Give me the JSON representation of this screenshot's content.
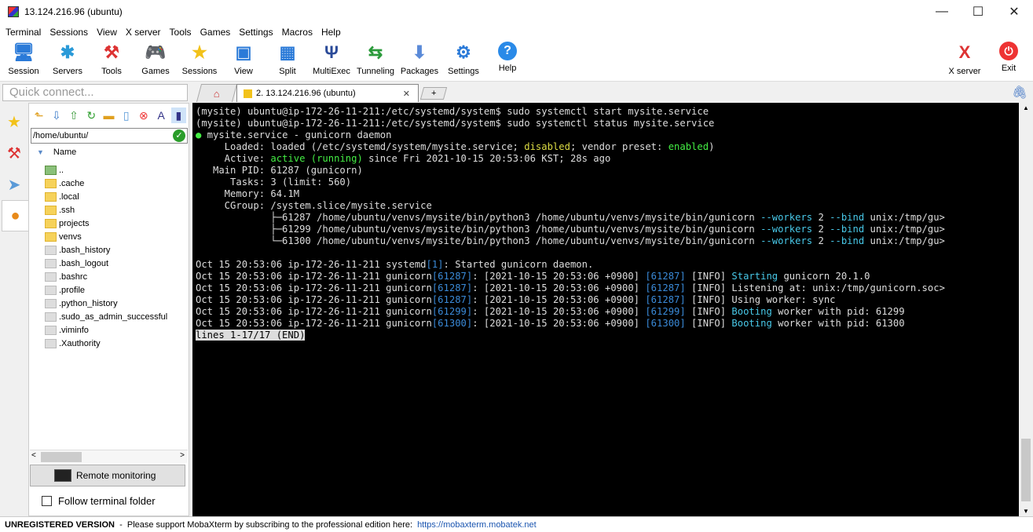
{
  "window": {
    "title": "13.124.216.96 (ubuntu)",
    "minimize": "—",
    "maximize": "☐",
    "close": "✕"
  },
  "menu": [
    "Terminal",
    "Sessions",
    "View",
    "X server",
    "Tools",
    "Games",
    "Settings",
    "Macros",
    "Help"
  ],
  "toolbar": [
    {
      "label": "Session",
      "icon": "monitor-icon"
    },
    {
      "label": "Servers",
      "icon": "servers-icon"
    },
    {
      "label": "Tools",
      "icon": "tools-icon"
    },
    {
      "label": "Games",
      "icon": "gamepad-icon"
    },
    {
      "label": "Sessions",
      "icon": "star-icon"
    },
    {
      "label": "View",
      "icon": "view-icon"
    },
    {
      "label": "Split",
      "icon": "split-icon"
    },
    {
      "label": "MultiExec",
      "icon": "multiexec-icon"
    },
    {
      "label": "Tunneling",
      "icon": "tunnel-icon"
    },
    {
      "label": "Packages",
      "icon": "packages-icon"
    },
    {
      "label": "Settings",
      "icon": "gears-icon"
    },
    {
      "label": "Help",
      "icon": "help-icon"
    }
  ],
  "toolbar_right": [
    {
      "label": "X server",
      "icon": "xserver-icon"
    },
    {
      "label": "Exit",
      "icon": "power-icon"
    }
  ],
  "quick_connect": {
    "placeholder": "Quick connect..."
  },
  "tabs": {
    "active": "2. 13.124.216.96 (ubuntu)",
    "close": "✕",
    "new": "+"
  },
  "sidebar": {
    "path": "/home/ubuntu/",
    "column": "Name",
    "files": [
      {
        "name": "..",
        "type": "up"
      },
      {
        "name": ".cache",
        "type": "folder"
      },
      {
        "name": ".local",
        "type": "folder"
      },
      {
        "name": ".ssh",
        "type": "folder"
      },
      {
        "name": "projects",
        "type": "folder"
      },
      {
        "name": "venvs",
        "type": "folder"
      },
      {
        "name": ".bash_history",
        "type": "file"
      },
      {
        "name": ".bash_logout",
        "type": "file"
      },
      {
        "name": ".bashrc",
        "type": "file"
      },
      {
        "name": ".profile",
        "type": "file"
      },
      {
        "name": ".python_history",
        "type": "file"
      },
      {
        "name": ".sudo_as_admin_successful",
        "type": "file"
      },
      {
        "name": ".viminfo",
        "type": "file"
      },
      {
        "name": ".Xauthority",
        "type": "file"
      }
    ],
    "remote_monitoring": "Remote monitoring",
    "follow_folder": "Follow terminal folder"
  },
  "terminal": {
    "lines": [
      [
        {
          "t": "(mysite) ubuntu@ip-172-26-11-211:/etc/systemd/system$ sudo systemctl start mysite.service"
        }
      ],
      [
        {
          "t": "(mysite) ubuntu@ip-172-26-11-211:/etc/systemd/system$ sudo systemctl status mysite.service"
        }
      ],
      [
        {
          "t": "●",
          "c": "g"
        },
        {
          "t": " mysite.service - gunicorn daemon"
        }
      ],
      [
        {
          "t": "     Loaded: loaded (/etc/systemd/system/mysite.service; "
        },
        {
          "t": "disabled",
          "c": "y"
        },
        {
          "t": "; vendor preset: "
        },
        {
          "t": "enabled",
          "c": "g"
        },
        {
          "t": ")"
        }
      ],
      [
        {
          "t": "     Active: "
        },
        {
          "t": "active (running)",
          "c": "g"
        },
        {
          "t": " since Fri 2021-10-15 20:53:06 KST; 28s ago"
        }
      ],
      [
        {
          "t": "   Main PID: 61287 (gunicorn)"
        }
      ],
      [
        {
          "t": "      Tasks: 3 (limit: 560)"
        }
      ],
      [
        {
          "t": "     Memory: 64.1M"
        }
      ],
      [
        {
          "t": "     CGroup: /system.slice/mysite.service"
        }
      ],
      [
        {
          "t": "             ├─61287 /home/ubuntu/venvs/mysite/bin/python3 /home/ubuntu/venvs/mysite/bin/gunicorn "
        },
        {
          "t": "--workers",
          "c": "c"
        },
        {
          "t": " 2 "
        },
        {
          "t": "--bind",
          "c": "c"
        },
        {
          "t": " unix:/tmp/gu>"
        }
      ],
      [
        {
          "t": "             ├─61299 /home/ubuntu/venvs/mysite/bin/python3 /home/ubuntu/venvs/mysite/bin/gunicorn "
        },
        {
          "t": "--workers",
          "c": "c"
        },
        {
          "t": " 2 "
        },
        {
          "t": "--bind",
          "c": "c"
        },
        {
          "t": " unix:/tmp/gu>"
        }
      ],
      [
        {
          "t": "             └─61300 /home/ubuntu/venvs/mysite/bin/python3 /home/ubuntu/venvs/mysite/bin/gunicorn "
        },
        {
          "t": "--workers",
          "c": "c"
        },
        {
          "t": " 2 "
        },
        {
          "t": "--bind",
          "c": "c"
        },
        {
          "t": " unix:/tmp/gu>"
        }
      ],
      [
        {
          "t": ""
        }
      ],
      [
        {
          "t": "Oct 15 20:53:06 ip-172-26-11-211 systemd"
        },
        {
          "t": "[1]",
          "c": "b"
        },
        {
          "t": ": Started gunicorn daemon."
        }
      ],
      [
        {
          "t": "Oct 15 20:53:06 ip-172-26-11-211 gunicorn"
        },
        {
          "t": "[61287]",
          "c": "b"
        },
        {
          "t": ": [2021-10-15 20:53:06 +0900] "
        },
        {
          "t": "[61287]",
          "c": "b"
        },
        {
          "t": " [INFO] "
        },
        {
          "t": "Starting",
          "c": "c"
        },
        {
          "t": " gunicorn 20.1.0"
        }
      ],
      [
        {
          "t": "Oct 15 20:53:06 ip-172-26-11-211 gunicorn"
        },
        {
          "t": "[61287]",
          "c": "b"
        },
        {
          "t": ": [2021-10-15 20:53:06 +0900] "
        },
        {
          "t": "[61287]",
          "c": "b"
        },
        {
          "t": " [INFO] Listening at: unix:/tmp/gunicorn.soc>"
        }
      ],
      [
        {
          "t": "Oct 15 20:53:06 ip-172-26-11-211 gunicorn"
        },
        {
          "t": "[61287]",
          "c": "b"
        },
        {
          "t": ": [2021-10-15 20:53:06 +0900] "
        },
        {
          "t": "[61287]",
          "c": "b"
        },
        {
          "t": " [INFO] Using worker: sync"
        }
      ],
      [
        {
          "t": "Oct 15 20:53:06 ip-172-26-11-211 gunicorn"
        },
        {
          "t": "[61299]",
          "c": "b"
        },
        {
          "t": ": [2021-10-15 20:53:06 +0900] "
        },
        {
          "t": "[61299]",
          "c": "b"
        },
        {
          "t": " [INFO] "
        },
        {
          "t": "Booting",
          "c": "c"
        },
        {
          "t": " worker with pid: 61299"
        }
      ],
      [
        {
          "t": "Oct 15 20:53:06 ip-172-26-11-211 gunicorn"
        },
        {
          "t": "[61300]",
          "c": "b"
        },
        {
          "t": ": [2021-10-15 20:53:06 +0900] "
        },
        {
          "t": "[61300]",
          "c": "b"
        },
        {
          "t": " [INFO] "
        },
        {
          "t": "Booting",
          "c": "c"
        },
        {
          "t": " worker with pid: 61300"
        }
      ],
      [
        {
          "t": "lines 1-17/17 (END)",
          "c": "inv"
        }
      ]
    ]
  },
  "status": {
    "unregistered": "UNREGISTERED VERSION",
    "message": "  -  Please support MobaXterm by subscribing to the professional edition here:",
    "link": "https://mobaxterm.mobatek.net"
  }
}
